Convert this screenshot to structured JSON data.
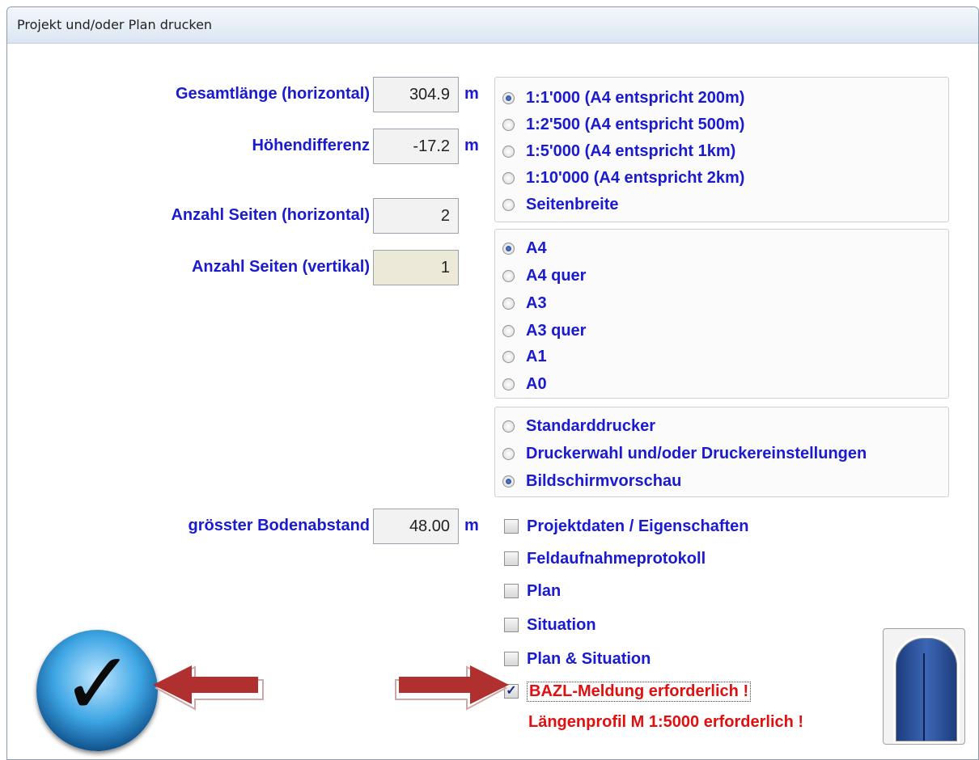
{
  "window": {
    "title": "Projekt und/oder Plan drucken"
  },
  "fields": {
    "gesamtlaenge": {
      "label": "Gesamtlänge (horizontal)",
      "value": "304.9",
      "unit": "m"
    },
    "hoehendifferenz": {
      "label": "Höhendifferenz",
      "value": "-17.2",
      "unit": "m"
    },
    "seiten_horizontal": {
      "label": "Anzahl Seiten (horizontal)",
      "value": "2"
    },
    "seiten_vertikal": {
      "label": "Anzahl Seiten (vertikal)",
      "value": "1"
    },
    "bodenabstand": {
      "label": "grösster Bodenabstand",
      "value": "48.00",
      "unit": "m"
    }
  },
  "scale_options": [
    {
      "label": "1:1'000 (A4 entspricht 200m)",
      "selected": true
    },
    {
      "label": "1:2'500 (A4 entspricht 500m)",
      "selected": false
    },
    {
      "label": "1:5'000 (A4 entspricht 1km)",
      "selected": false
    },
    {
      "label": "1:10'000 (A4 entspricht 2km)",
      "selected": false
    },
    {
      "label": "Seitenbreite",
      "selected": false
    }
  ],
  "paper_options": [
    {
      "label": "A4",
      "selected": true
    },
    {
      "label": "A4 quer",
      "selected": false
    },
    {
      "label": "A3",
      "selected": false
    },
    {
      "label": "A3 quer",
      "selected": false
    },
    {
      "label": "A1",
      "selected": false
    },
    {
      "label": "A0",
      "selected": false
    }
  ],
  "printer_options": [
    {
      "label": "Standarddrucker",
      "selected": false
    },
    {
      "label": "Druckerwahl und/oder Druckereinstellungen",
      "selected": false
    },
    {
      "label": "Bildschirmvorschau",
      "selected": true
    }
  ],
  "print_checks": [
    {
      "label": "Projektdaten / Eigenschaften",
      "checked": false
    },
    {
      "label": "Feldaufnahmeprotokoll",
      "checked": false
    },
    {
      "label": "Plan",
      "checked": false
    },
    {
      "label": "Situation",
      "checked": false
    },
    {
      "label": "Plan & Situation",
      "checked": false
    },
    {
      "label": "BAZL-Meldung erforderlich !",
      "checked": true
    }
  ],
  "warning_text": "Längenprofil M 1:5000 erforderlich !",
  "check_mark": "✓",
  "colors": {
    "label_blue": "#1a1ad0",
    "warning_red": "#e01010",
    "arrow_red": "#b03030"
  },
  "icons": {
    "ok_button": "checkmark-icon",
    "exit_button": "door-icon"
  }
}
